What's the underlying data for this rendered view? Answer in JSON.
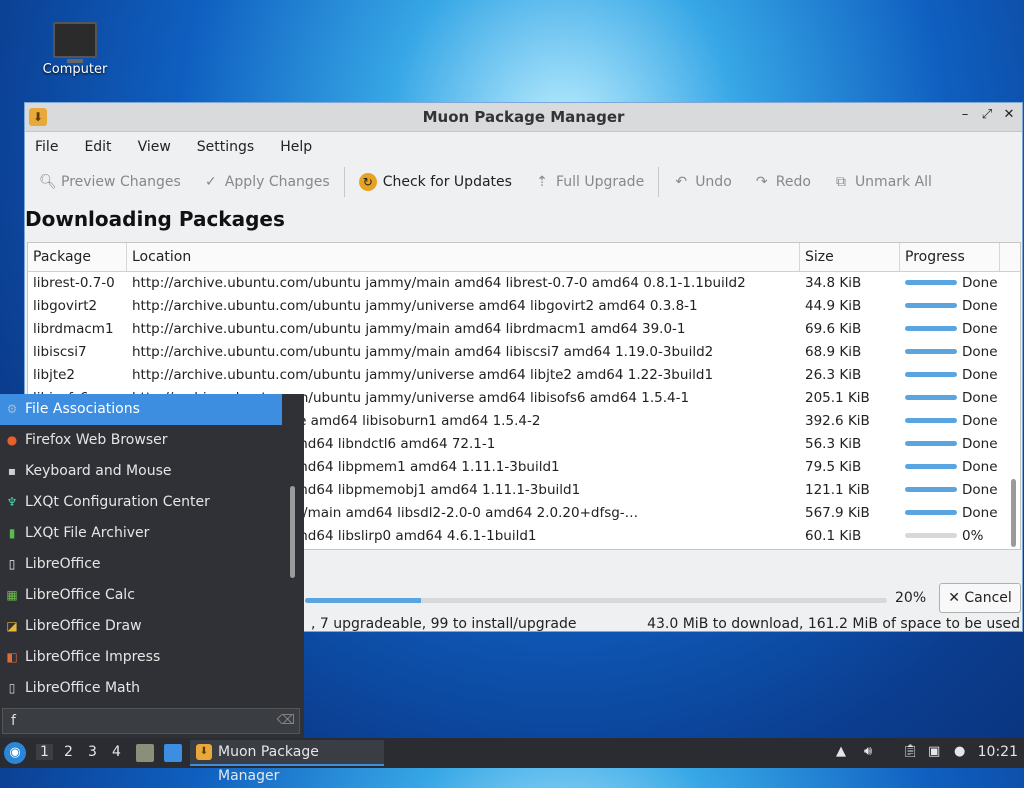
{
  "desktop": {
    "computer_label": "Computer"
  },
  "window": {
    "title": "Muon Package Manager",
    "menu": [
      "File",
      "Edit",
      "View",
      "Settings",
      "Help"
    ],
    "toolbar": {
      "preview": "Preview Changes",
      "apply": "Apply Changes",
      "check": "Check for Updates",
      "upgrade": "Full Upgrade",
      "undo": "Undo",
      "redo": "Redo",
      "unmark": "Unmark All"
    },
    "heading": "Downloading Packages",
    "columns": {
      "package": "Package",
      "location": "Location",
      "size": "Size",
      "progress": "Progress"
    },
    "rows": [
      {
        "pkg": "librest-0.7-0",
        "loc": "http://archive.ubuntu.com/ubuntu jammy/main amd64 librest-0.7-0 amd64 0.8.1-1.1build2",
        "size": "34.8 KiB",
        "progress": 1,
        "status": "Done"
      },
      {
        "pkg": "libgovirt2",
        "loc": "http://archive.ubuntu.com/ubuntu jammy/universe amd64 libgovirt2 amd64 0.3.8-1",
        "size": "44.9 KiB",
        "progress": 1,
        "status": "Done"
      },
      {
        "pkg": "librdmacm1",
        "loc": "http://archive.ubuntu.com/ubuntu jammy/main amd64 librdmacm1 amd64 39.0-1",
        "size": "69.6 KiB",
        "progress": 1,
        "status": "Done"
      },
      {
        "pkg": "libiscsi7",
        "loc": "http://archive.ubuntu.com/ubuntu jammy/main amd64 libiscsi7 amd64 1.19.0-3build2",
        "size": "68.9 KiB",
        "progress": 1,
        "status": "Done"
      },
      {
        "pkg": "libjte2",
        "loc": "http://archive.ubuntu.com/ubuntu jammy/universe amd64 libjte2 amd64 1.22-3build1",
        "size": "26.3 KiB",
        "progress": 1,
        "status": "Done"
      },
      {
        "pkg": "libisofs6",
        "loc": "http://archive.ubuntu.com/ubuntu jammy/universe amd64 libisofs6 amd64 1.5.4-1",
        "size": "205.1 KiB",
        "progress": 1,
        "status": "Done"
      },
      {
        "pkg": "",
        "loc": "n/ubuntu jammy/universe amd64 libisoburn1 amd64 1.5.4-2",
        "size": "392.6 KiB",
        "progress": 1,
        "status": "Done"
      },
      {
        "pkg": "",
        "loc": "n/ubuntu jammy/main amd64 libndctl6 amd64 72.1-1",
        "size": "56.3 KiB",
        "progress": 1,
        "status": "Done"
      },
      {
        "pkg": "",
        "loc": "n/ubuntu jammy/main amd64 libpmem1 amd64 1.11.1-3build1",
        "size": "79.5 KiB",
        "progress": 1,
        "status": "Done"
      },
      {
        "pkg": "",
        "loc": "n/ubuntu jammy/main amd64 libpmemobj1 amd64 1.11.1-3build1",
        "size": "121.1 KiB",
        "progress": 1,
        "status": "Done"
      },
      {
        "pkg": "",
        "loc": "n/ubuntu jammy-updates/main amd64 libsdl2-2.0-0 amd64 2.0.20+dfsg-…",
        "size": "567.9 KiB",
        "progress": 1,
        "status": "Done"
      },
      {
        "pkg": "",
        "loc": "n/ubuntu jammy/main amd64 libslirp0 amd64 4.6.1-1build1",
        "size": "60.1 KiB",
        "progress": 0,
        "status": "0%"
      }
    ],
    "overall_progress": 0.2,
    "overall_label": "20%",
    "cancel_label": "Cancel",
    "status_left": ", 7 upgradeable, 99 to install/upgrade",
    "status_right": "43.0 MiB to download, 161.2 MiB of space to be used"
  },
  "launcher": {
    "items": [
      {
        "label": "File Associations",
        "icon": "gear-icon",
        "glyph": "⚙",
        "color": "#9fb8d8"
      },
      {
        "label": "Firefox Web Browser",
        "icon": "firefox-icon",
        "glyph": "●",
        "color": "#e8602c"
      },
      {
        "label": "Keyboard and Mouse",
        "icon": "mouse-icon",
        "glyph": "▪",
        "color": "#cfcfcf"
      },
      {
        "label": "LXQt Configuration Center",
        "icon": "config-icon",
        "glyph": "♆",
        "color": "#4fd1a5"
      },
      {
        "label": "LXQt File Archiver",
        "icon": "archive-icon",
        "glyph": "▮",
        "color": "#5cbc4a"
      },
      {
        "label": "LibreOffice",
        "icon": "libreoffice-icon",
        "glyph": "▯",
        "color": "#f2f2f2"
      },
      {
        "label": "LibreOffice Calc",
        "icon": "calc-icon",
        "glyph": "▦",
        "color": "#6fbf4a"
      },
      {
        "label": "LibreOffice Draw",
        "icon": "draw-icon",
        "glyph": "◪",
        "color": "#e8b83a"
      },
      {
        "label": "LibreOffice Impress",
        "icon": "impress-icon",
        "glyph": "◧",
        "color": "#e06a3a"
      },
      {
        "label": "LibreOffice Math",
        "icon": "math-icon",
        "glyph": "▯",
        "color": "#d8d8d8"
      }
    ],
    "search_value": "f"
  },
  "taskbar": {
    "workspaces": [
      "1",
      "2",
      "3",
      "4"
    ],
    "task_title": "Muon Package Manager",
    "clock": "10:21"
  }
}
